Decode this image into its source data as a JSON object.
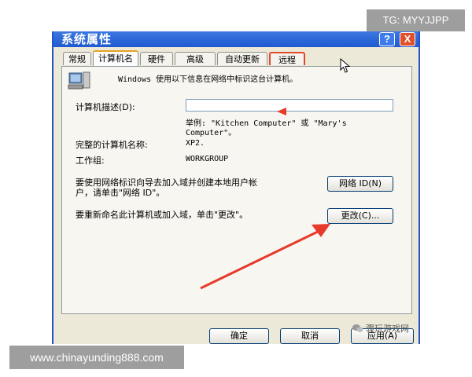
{
  "overlay": {
    "tg_badge": "TG: MYYJJPP",
    "site_badge": "www.chinayunding888.com",
    "watermark_text": "骤玩游戏网"
  },
  "window": {
    "title": "系统属性",
    "help_button": "?",
    "close_button": "X"
  },
  "tabs": [
    {
      "label": "常规",
      "active": false
    },
    {
      "label": "计算机名",
      "active": true
    },
    {
      "label": "硬件",
      "active": false
    },
    {
      "label": "高级",
      "active": false
    },
    {
      "label": "自动更新",
      "active": false
    },
    {
      "label": "远程",
      "active": false
    }
  ],
  "computer_name_tab": {
    "intro": "Windows 使用以下信息在网络中标识这台计算机。",
    "description_label": "计算机描述(D):",
    "description_value": "",
    "example_line1": "举例: \"Kitchen Computer\" 或 \"Mary's",
    "example_line2": "Computer\"。",
    "full_name_label": "完整的计算机名称:",
    "full_name_value": "XP2.",
    "workgroup_label": "工作组:",
    "workgroup_value": "WORKGROUP",
    "network_id_text_line1": "要使用网络标识向导去加入域并创建本地用户帐",
    "network_id_text_line2": "户，请单击\"网络 ID\"。",
    "network_id_button": "网络 ID(N)",
    "rename_text": "要重新命名此计算机或加入域，单击\"更改\"。",
    "change_button": "更改(C)..."
  },
  "footer": {
    "ok_button": "确定",
    "cancel_button": "取消",
    "apply_button": "应用(A)"
  },
  "colors": {
    "title_bar": "#2a62d8",
    "dialog_bg": "#ece9d8",
    "annotation_red": "#e83a2a"
  }
}
